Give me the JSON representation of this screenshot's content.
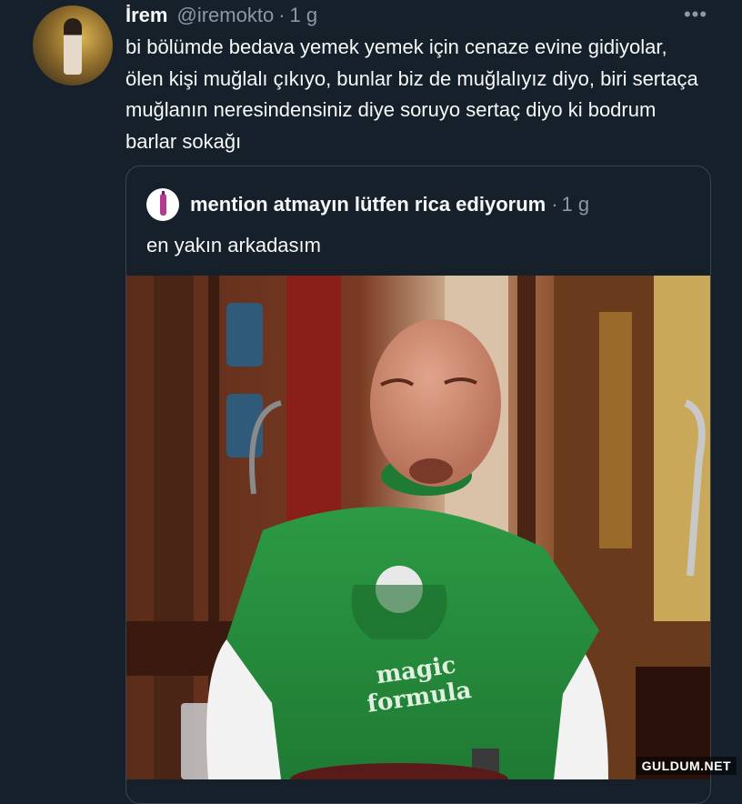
{
  "tweet": {
    "author_name": "İrem",
    "author_handle": "@iremokto",
    "separator": "·",
    "time": "1 g",
    "more_icon": "more-dots-icon",
    "text": "bi bölümde bedava yemek yemek için cenaze evine gidiyolar, ölen kişi muğlalı çıkıyo, bunlar biz de muğlalıyız diyo, biri sertaça muğlanın neresindensiniz diye soruyo sertaç diyo ki bodrum barlar sokağı"
  },
  "quote": {
    "author_name": "mention atmayın lütfen rica ediyorum",
    "separator": "·",
    "time": "1 g",
    "text": "en yakın arkadasım",
    "media": {
      "shirt_text_line1": "magic",
      "shirt_text_line2": "formula"
    }
  },
  "watermark": "GULDUM.NET",
  "colors": {
    "background": "#15202b",
    "text_primary": "#f7f9f9",
    "text_secondary": "#8b98a5",
    "border": "#38444d"
  }
}
